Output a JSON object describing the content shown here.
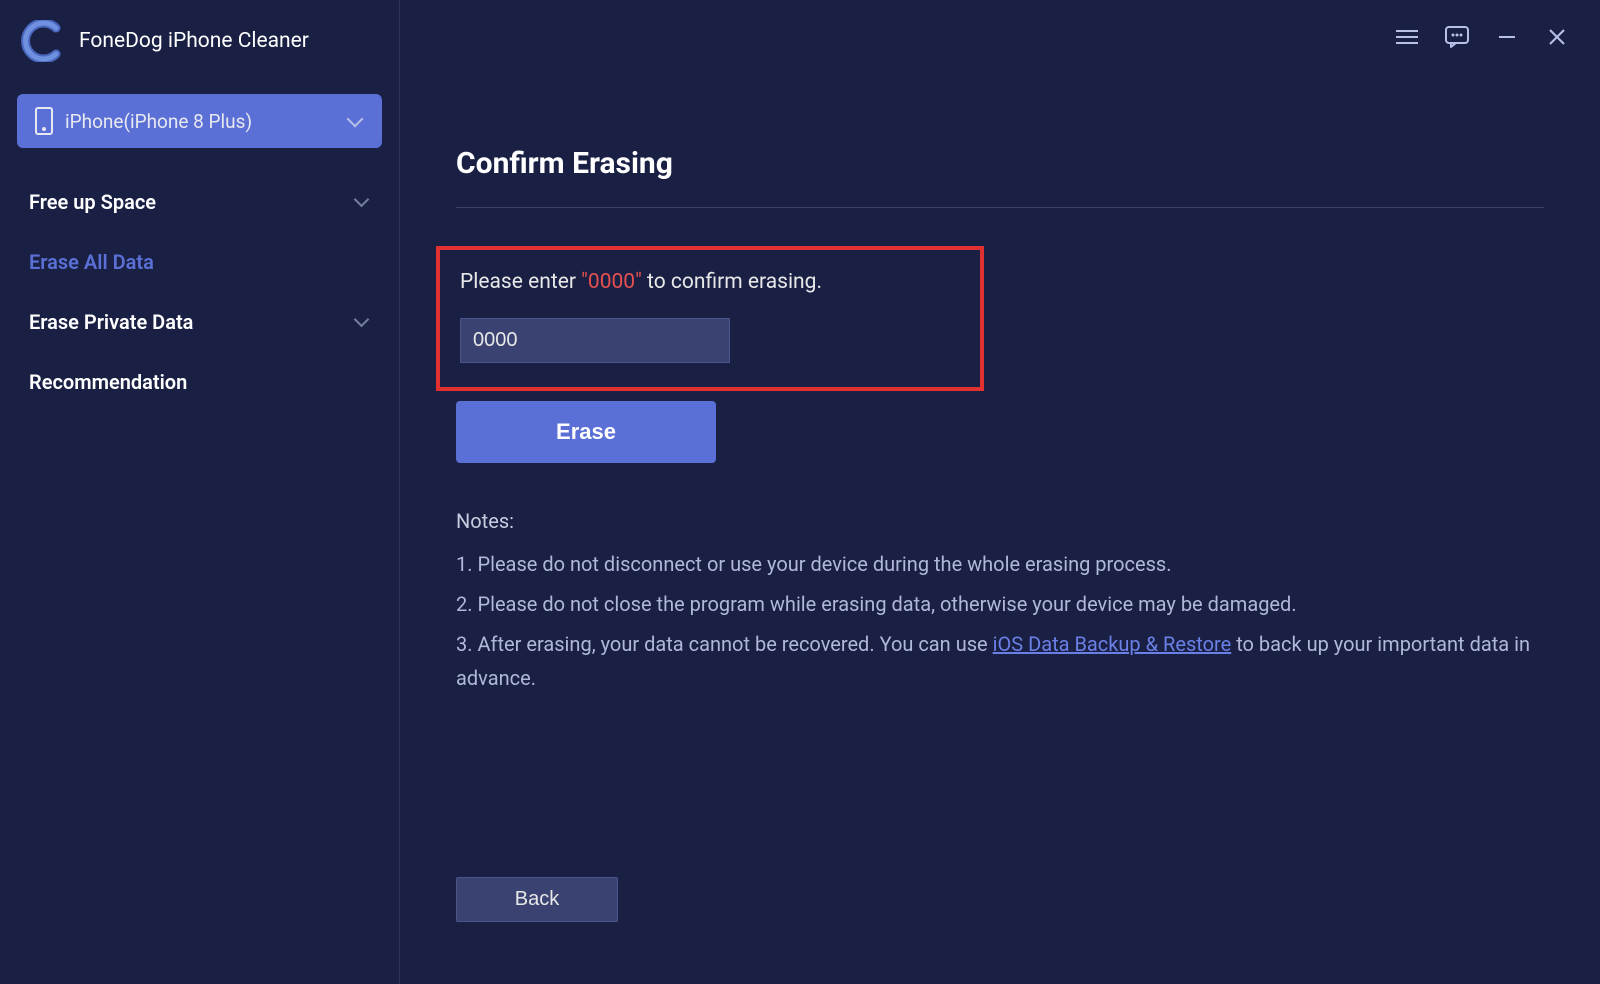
{
  "app": {
    "title": "FoneDog iPhone Cleaner"
  },
  "device": {
    "name": "iPhone(iPhone 8 Plus)"
  },
  "sidebar": {
    "items": [
      {
        "label": "Free up Space",
        "expandable": true
      },
      {
        "label": "Erase All Data",
        "active": true
      },
      {
        "label": "Erase Private Data",
        "expandable": true
      },
      {
        "label": "Recommendation"
      }
    ]
  },
  "main": {
    "title": "Confirm Erasing",
    "confirmPrefix": "Please enter ",
    "confirmCode": "\"0000\"",
    "confirmSuffix": " to confirm erasing.",
    "inputValue": "0000",
    "eraseLabel": "Erase",
    "notes": {
      "title": "Notes:",
      "items": [
        "1. Please do not disconnect or use your device during the whole erasing process.",
        "2. Please do not close the program while erasing data, otherwise your device may be damaged."
      ],
      "item3Prefix": "3. After erasing, your data cannot be recovered. You can use ",
      "item3Link": "iOS Data Backup & Restore",
      "item3Suffix": " to back up your important data in advance."
    },
    "backLabel": "Back"
  }
}
